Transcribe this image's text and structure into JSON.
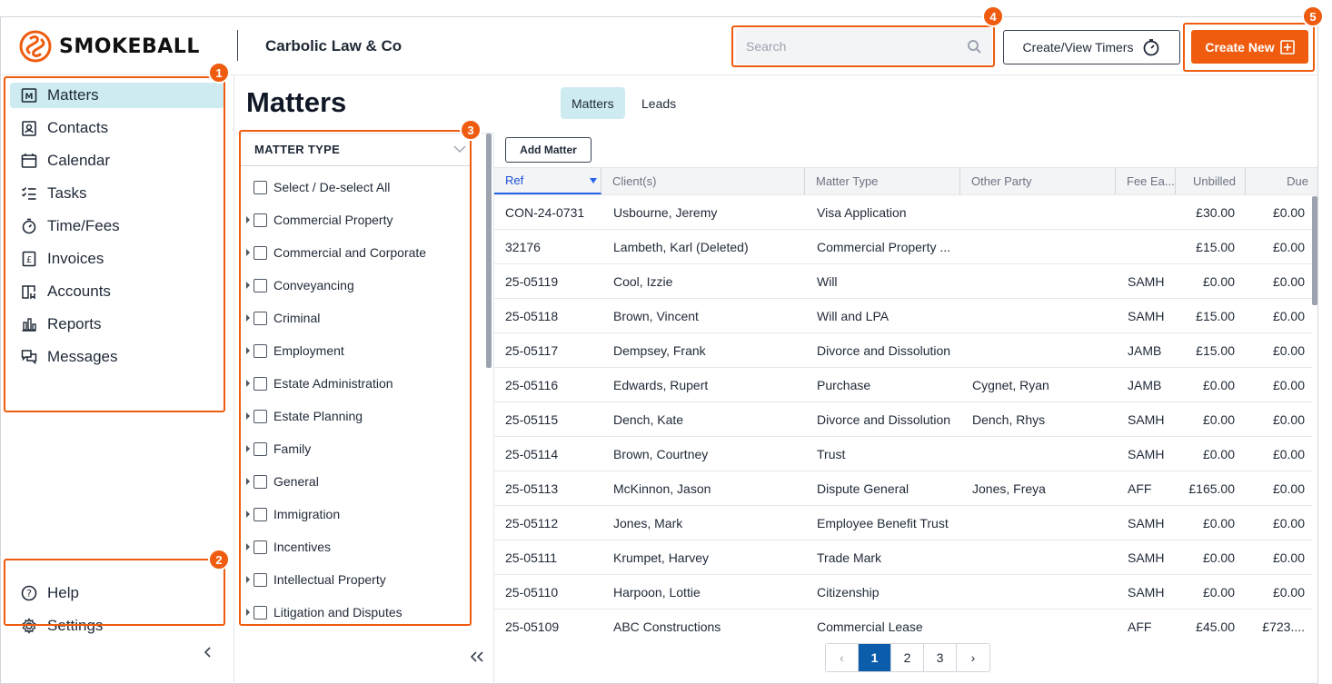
{
  "header": {
    "logo_text": "SMOKEBALL",
    "firm_name": "Carbolic Law & Co",
    "search_placeholder": "Search",
    "timers_label": "Create/View Timers",
    "create_label": "Create New"
  },
  "sidebar": {
    "items": [
      {
        "label": "Matters",
        "icon": "matters-icon"
      },
      {
        "label": "Contacts",
        "icon": "contacts-icon"
      },
      {
        "label": "Calendar",
        "icon": "calendar-icon"
      },
      {
        "label": "Tasks",
        "icon": "tasks-icon"
      },
      {
        "label": "Time/Fees",
        "icon": "stopwatch-icon"
      },
      {
        "label": "Invoices",
        "icon": "invoice-icon"
      },
      {
        "label": "Accounts",
        "icon": "accounts-icon"
      },
      {
        "label": "Reports",
        "icon": "reports-icon"
      },
      {
        "label": "Messages",
        "icon": "messages-icon"
      }
    ],
    "footer": [
      {
        "label": "Help",
        "icon": "help-icon"
      },
      {
        "label": "Settings",
        "icon": "gear-icon"
      }
    ]
  },
  "page": {
    "title": "Matters",
    "tabs": [
      "Matters",
      "Leads"
    ]
  },
  "filter": {
    "heading": "MATTER TYPE",
    "select_all": "Select / De-select All",
    "items": [
      "Commercial Property",
      "Commercial and Corporate",
      "Conveyancing",
      "Criminal",
      "Employment",
      "Estate Administration",
      "Estate Planning",
      "Family",
      "General",
      "Immigration",
      "Incentives",
      "Intellectual Property",
      "Litigation and Disputes"
    ]
  },
  "table": {
    "add_label": "Add Matter",
    "columns": [
      "Ref",
      "Client(s)",
      "Matter Type",
      "Other Party",
      "Fee Ea...",
      "Unbilled",
      "Due"
    ],
    "rows": [
      [
        "CON-24-0731",
        "Usbourne, Jeremy",
        "Visa Application",
        "",
        "",
        "£30.00",
        "£0.00"
      ],
      [
        "32176",
        "Lambeth, Karl (Deleted)",
        "Commercial Property ...",
        "",
        "",
        "£15.00",
        "£0.00"
      ],
      [
        "25-05119",
        "Cool, Izzie",
        "Will",
        "",
        "SAMH",
        "£0.00",
        "£0.00"
      ],
      [
        "25-05118",
        "Brown, Vincent",
        "Will and LPA",
        "",
        "SAMH",
        "£15.00",
        "£0.00"
      ],
      [
        "25-05117",
        "Dempsey, Frank",
        "Divorce and Dissolution",
        "",
        "JAMB",
        "£15.00",
        "£0.00"
      ],
      [
        "25-05116",
        "Edwards, Rupert",
        "Purchase",
        "Cygnet, Ryan",
        "JAMB",
        "£0.00",
        "£0.00"
      ],
      [
        "25-05115",
        "Dench, Kate",
        "Divorce and Dissolution",
        "Dench, Rhys",
        "SAMH",
        "£0.00",
        "£0.00"
      ],
      [
        "25-05114",
        "Brown, Courtney",
        "Trust",
        "",
        "SAMH",
        "£0.00",
        "£0.00"
      ],
      [
        "25-05113",
        "McKinnon, Jason",
        "Dispute General",
        "Jones, Freya",
        "AFF",
        "£165.00",
        "£0.00"
      ],
      [
        "25-05112",
        "Jones, Mark",
        "Employee Benefit Trust",
        "",
        "SAMH",
        "£0.00",
        "£0.00"
      ],
      [
        "25-05111",
        "Krumpet, Harvey",
        "Trade Mark",
        "",
        "SAMH",
        "£0.00",
        "£0.00"
      ],
      [
        "25-05110",
        "Harpoon, Lottie",
        "Citizenship",
        "",
        "SAMH",
        "£0.00",
        "£0.00"
      ],
      [
        "25-05109",
        "ABC Constructions",
        "Commercial Lease",
        "",
        "AFF",
        "£45.00",
        "£723...."
      ]
    ]
  },
  "pagination": {
    "prev": "‹",
    "pages": [
      "1",
      "2",
      "3"
    ],
    "next": "›",
    "current": "1"
  },
  "callouts": [
    "1",
    "2",
    "3",
    "4",
    "5"
  ],
  "colors": {
    "accent": "#ef5c0f",
    "active_tab": "#cdebf1",
    "pager_active": "#0b5cab"
  }
}
